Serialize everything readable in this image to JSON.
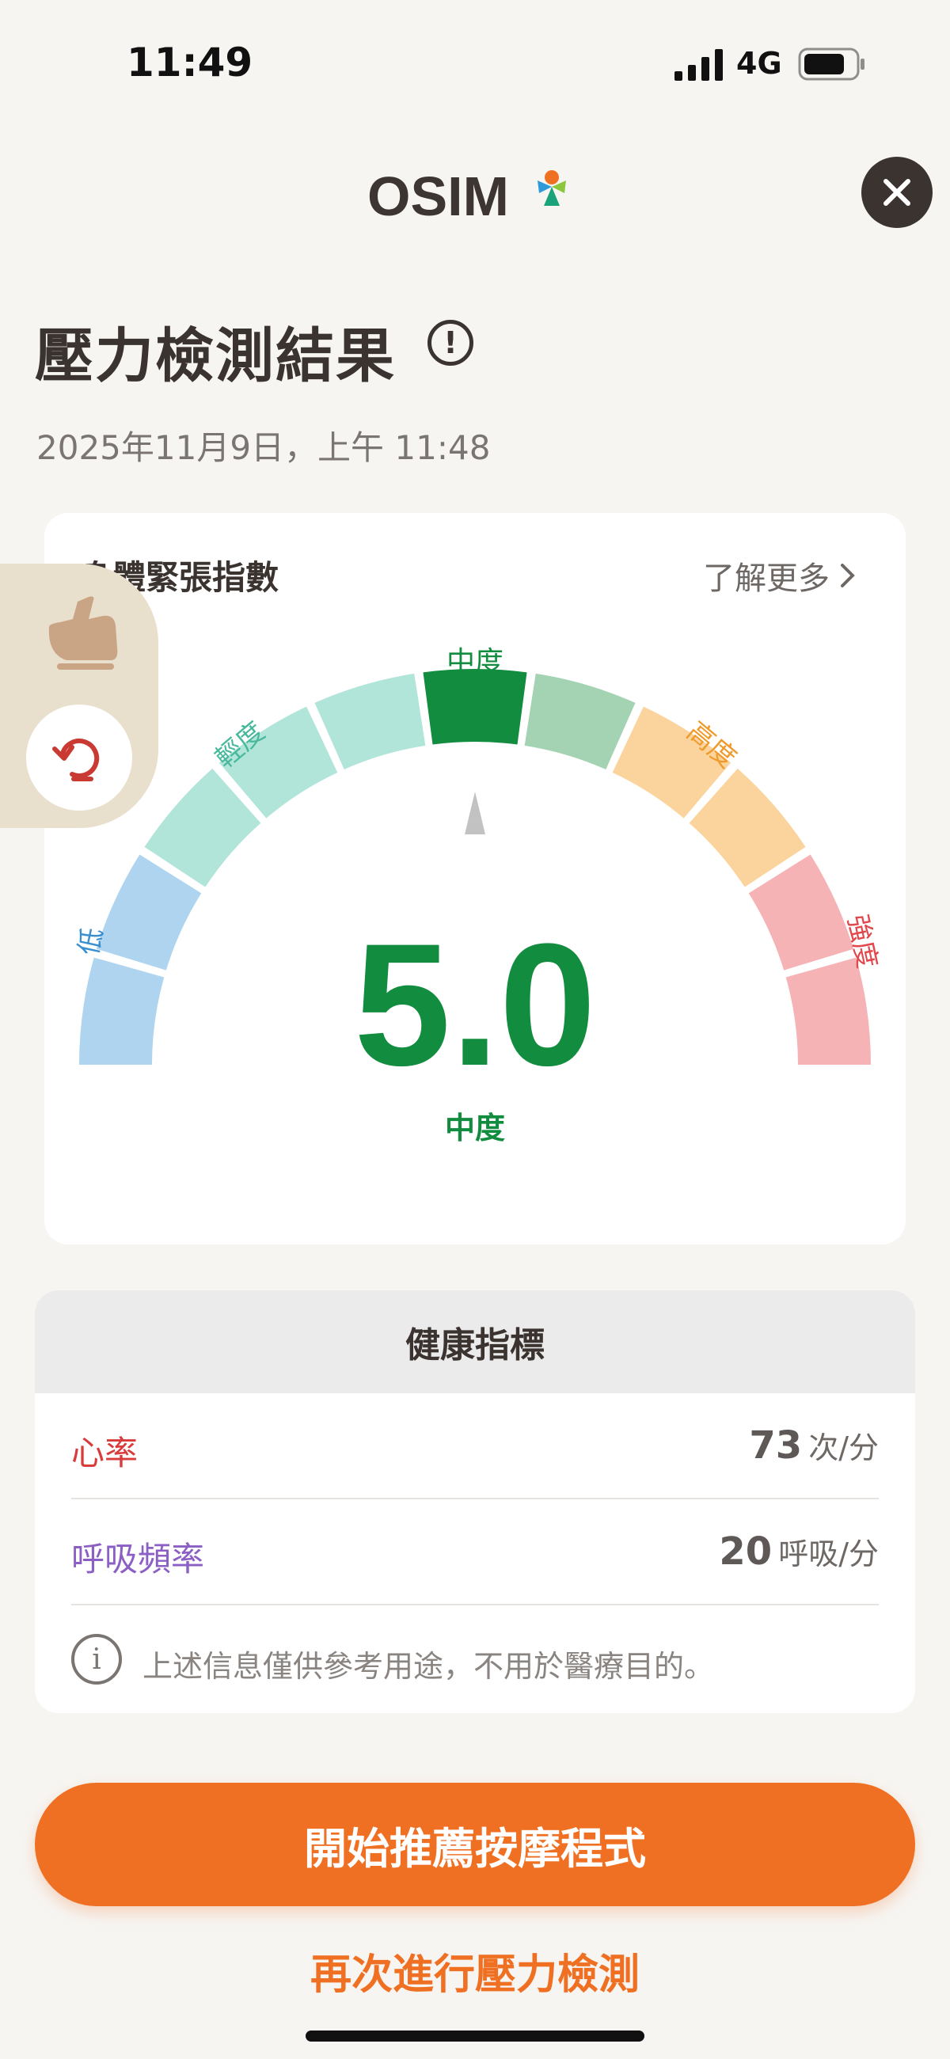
{
  "status_bar": {
    "time": "11:49",
    "network": "4G"
  },
  "header": {
    "brand": "OSIM"
  },
  "page": {
    "title": "壓力檢測結果",
    "date": "2025年11月9日，上午 11:48"
  },
  "stress_card": {
    "label": "身體緊張指數",
    "learn_more": "了解更多",
    "score": "5.0",
    "level": "中度",
    "segment_labels": {
      "low": "低",
      "mild": "輕度",
      "moderate": "中度",
      "high": "高度",
      "severe": "強度"
    },
    "colors": {
      "low": "#aed4f0",
      "mild": "#b2e5da",
      "moderate_active": "#128c3e",
      "moderate": "#a3d3b2",
      "high": "#fbd39c",
      "severe": "#f6b3b6",
      "score": "#128c3e"
    }
  },
  "health": {
    "title": "健康指標",
    "heart_rate": {
      "label": "心率",
      "value": "73",
      "unit": "次/分",
      "color": "#d93a3a"
    },
    "breathing": {
      "label": "呼吸頻率",
      "value": "20",
      "unit": "呼吸/分",
      "color": "#8b5fc4"
    },
    "disclaimer": "上述信息僅供參考用途，不用於醫療目的。"
  },
  "actions": {
    "primary": "開始推薦按摩程式",
    "secondary": "再次進行壓力檢測"
  }
}
